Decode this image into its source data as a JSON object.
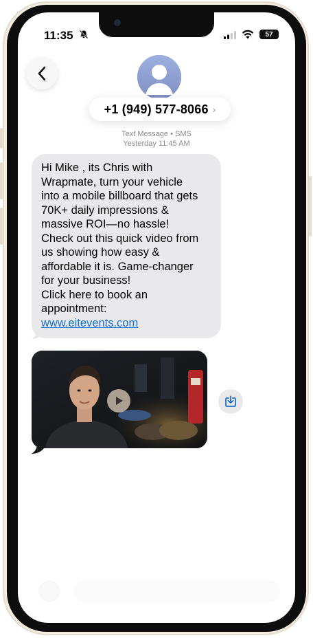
{
  "status_bar": {
    "time": "11:35",
    "battery": "57"
  },
  "header": {
    "contact_number": "+1 (949) 577-8066",
    "chevron": "›"
  },
  "conversation": {
    "service": "Text Message • SMS",
    "timestamp": "Yesterday 11:45 AM",
    "message_text": "Hi Mike , its Chris with\nWrapmate, turn your vehicle\ninto a mobile billboard that gets\n70K+ daily impressions &\nmassive ROI—no hassle!\nCheck out this quick video from\nus showing how easy &\naffordable it is. Game-changer\nfor your business!\nClick here to book an\nappointment:",
    "message_link": "www.eitevents.com"
  },
  "icons": {
    "back": "chevron-left-icon",
    "mute": "bell-slash-icon",
    "signal": "cellular-signal-icon",
    "wifi": "wifi-icon",
    "play": "play-icon",
    "save": "save-to-device-icon"
  },
  "colors": {
    "bubble_gray": "#e9e9eb",
    "link_blue": "#1b6fd4",
    "avatar": "#8e9dcf",
    "frame": "#f3ece1"
  }
}
